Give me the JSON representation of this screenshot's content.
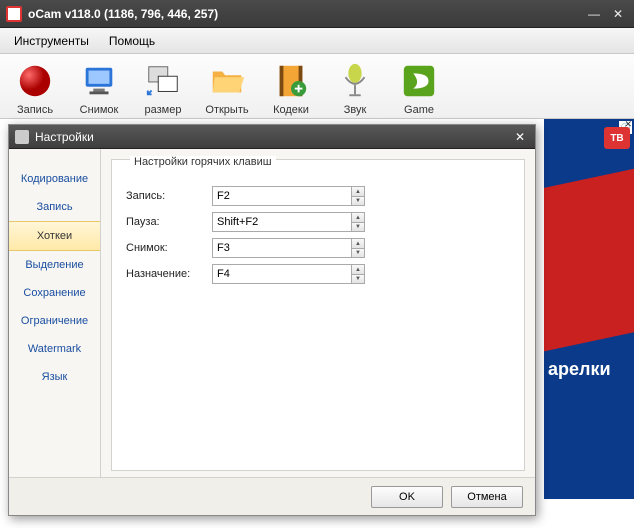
{
  "window": {
    "title": "oCam v118.0 (1186, 796, 446, 257)",
    "menu": {
      "tools": "Инструменты",
      "help": "Помощь"
    }
  },
  "toolbar": {
    "record": "Запись",
    "capture": "Снимок",
    "resize": "размер",
    "open": "Открыть",
    "codecs": "Кодеки",
    "sound": "Звук",
    "game": "Game"
  },
  "banner": {
    "tv": "ТВ",
    "text": "арелки"
  },
  "dialog": {
    "title": "Настройки",
    "sidebar": {
      "encoding": "Кодирование",
      "record": "Запись",
      "hotkeys": "Хоткеи",
      "selection": "Выделение",
      "saving": "Сохранение",
      "limit": "Ограничение",
      "watermark": "Watermark",
      "lang": "Язык"
    },
    "group": "Настройки горячих клавиш",
    "rows": {
      "record": {
        "label": "Запись:",
        "value": "F2"
      },
      "pause": {
        "label": "Пауза:",
        "value": "Shift+F2"
      },
      "shot": {
        "label": "Снимок:",
        "value": "F3"
      },
      "assign": {
        "label": "Назначение:",
        "value": "F4"
      }
    },
    "buttons": {
      "ok": "OK",
      "cancel": "Отмена"
    }
  }
}
